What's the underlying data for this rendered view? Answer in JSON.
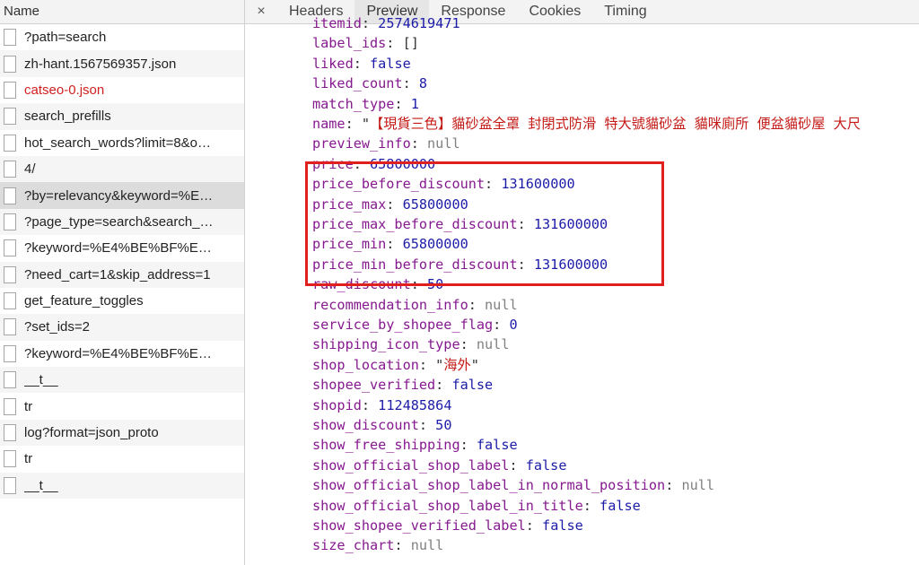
{
  "left": {
    "header": "Name",
    "requests": [
      {
        "name": "?path=search",
        "selected": false,
        "error": false
      },
      {
        "name": "zh-hant.1567569357.json",
        "selected": false,
        "error": false
      },
      {
        "name": "catseo-0.json",
        "selected": false,
        "error": true
      },
      {
        "name": "search_prefills",
        "selected": false,
        "error": false
      },
      {
        "name": "hot_search_words?limit=8&o…",
        "selected": false,
        "error": false
      },
      {
        "name": "4/",
        "selected": false,
        "error": false
      },
      {
        "name": "?by=relevancy&keyword=%E…",
        "selected": true,
        "error": false
      },
      {
        "name": "?page_type=search&search_…",
        "selected": false,
        "error": false
      },
      {
        "name": "?keyword=%E4%BE%BF%E…",
        "selected": false,
        "error": false
      },
      {
        "name": "?need_cart=1&skip_address=1",
        "selected": false,
        "error": false
      },
      {
        "name": "get_feature_toggles",
        "selected": false,
        "error": false
      },
      {
        "name": "?set_ids=2",
        "selected": false,
        "error": false
      },
      {
        "name": "?keyword=%E4%BE%BF%E…",
        "selected": false,
        "error": false
      },
      {
        "name": "__t__",
        "selected": false,
        "error": false
      },
      {
        "name": "tr",
        "selected": false,
        "error": false
      },
      {
        "name": "log?format=json_proto",
        "selected": false,
        "error": false
      },
      {
        "name": "tr",
        "selected": false,
        "error": false
      },
      {
        "name": "__t__",
        "selected": false,
        "error": false
      }
    ]
  },
  "tabs": {
    "close": "×",
    "items": [
      "Headers",
      "Preview",
      "Response",
      "Cookies",
      "Timing"
    ],
    "active": "Preview"
  },
  "preview": {
    "rows": [
      {
        "key": "itemid",
        "value": "2574619471",
        "type": "num"
      },
      {
        "key": "label_ids",
        "value": "[]",
        "type": "arr"
      },
      {
        "key": "liked",
        "value": "false",
        "type": "bool"
      },
      {
        "key": "liked_count",
        "value": "8",
        "type": "num"
      },
      {
        "key": "match_type",
        "value": "1",
        "type": "num"
      },
      {
        "key": "name",
        "value": "【現貨三色】貓砂盆全罩 封閉式防滑 特大號貓砂盆 貓咪廁所 便盆貓砂屋 大尺",
        "type": "str"
      },
      {
        "key": "preview_info",
        "value": "null",
        "type": "null"
      },
      {
        "key": "price",
        "value": "65800000",
        "type": "num"
      },
      {
        "key": "price_before_discount",
        "value": "131600000",
        "type": "num"
      },
      {
        "key": "price_max",
        "value": "65800000",
        "type": "num"
      },
      {
        "key": "price_max_before_discount",
        "value": "131600000",
        "type": "num"
      },
      {
        "key": "price_min",
        "value": "65800000",
        "type": "num"
      },
      {
        "key": "price_min_before_discount",
        "value": "131600000",
        "type": "num"
      },
      {
        "key": "raw_discount",
        "value": "50",
        "type": "num"
      },
      {
        "key": "recommendation_info",
        "value": "null",
        "type": "null"
      },
      {
        "key": "service_by_shopee_flag",
        "value": "0",
        "type": "num"
      },
      {
        "key": "shipping_icon_type",
        "value": "null",
        "type": "null"
      },
      {
        "key": "shop_location",
        "value": "海外",
        "type": "str"
      },
      {
        "key": "shopee_verified",
        "value": "false",
        "type": "bool"
      },
      {
        "key": "shopid",
        "value": "112485864",
        "type": "num"
      },
      {
        "key": "show_discount",
        "value": "50",
        "type": "num"
      },
      {
        "key": "show_free_shipping",
        "value": "false",
        "type": "bool"
      },
      {
        "key": "show_official_shop_label",
        "value": "false",
        "type": "bool"
      },
      {
        "key": "show_official_shop_label_in_normal_position",
        "value": "null",
        "type": "null"
      },
      {
        "key": "show_official_shop_label_in_title",
        "value": "false",
        "type": "bool"
      },
      {
        "key": "show_shopee_verified_label",
        "value": "false",
        "type": "bool"
      },
      {
        "key": "size_chart",
        "value": "null",
        "type": "null"
      }
    ]
  },
  "colors": {
    "highlight_box": "#e0201f",
    "key": "#86198f",
    "number": "#1c1ca8",
    "string": "#c41a16",
    "null": "#808080"
  }
}
